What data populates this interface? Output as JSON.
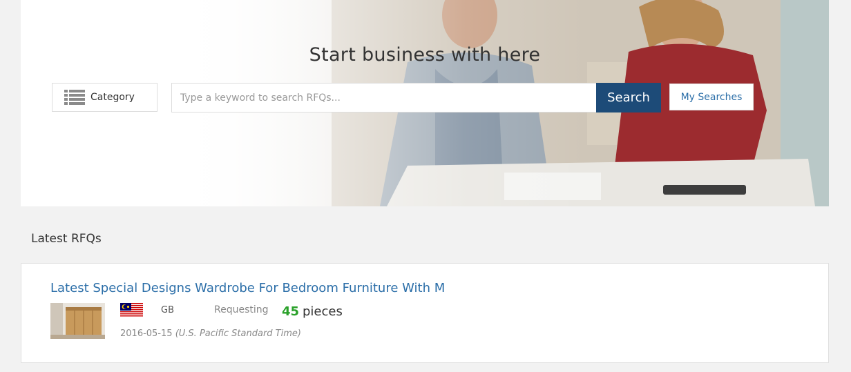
{
  "hero": {
    "title": "Start business with here",
    "category_label": "Category",
    "search_placeholder": "Type a keyword to search RFQs...",
    "search_button": "Search",
    "my_searches_button": "My Searches"
  },
  "latest": {
    "section_title": "Latest RFQs",
    "items": [
      {
        "title": "Latest Special Designs Wardrobe For Bedroom Furniture With M",
        "country": "GB",
        "requesting_label": "Requesting",
        "quantity": "45",
        "unit": "pieces",
        "date": "2016-05-15",
        "timezone": "(U.S. Pacific Standard Time)"
      }
    ]
  },
  "colors": {
    "accent_dark_blue": "#1d4b78",
    "link_blue": "#2b6ea8",
    "quantity_green": "#2aa12a",
    "page_background": "#f2f2f2"
  },
  "icons": {
    "category": "list-icon",
    "flag": "malaysia-flag-icon",
    "thumbnail": "wardrobe-thumbnail"
  }
}
